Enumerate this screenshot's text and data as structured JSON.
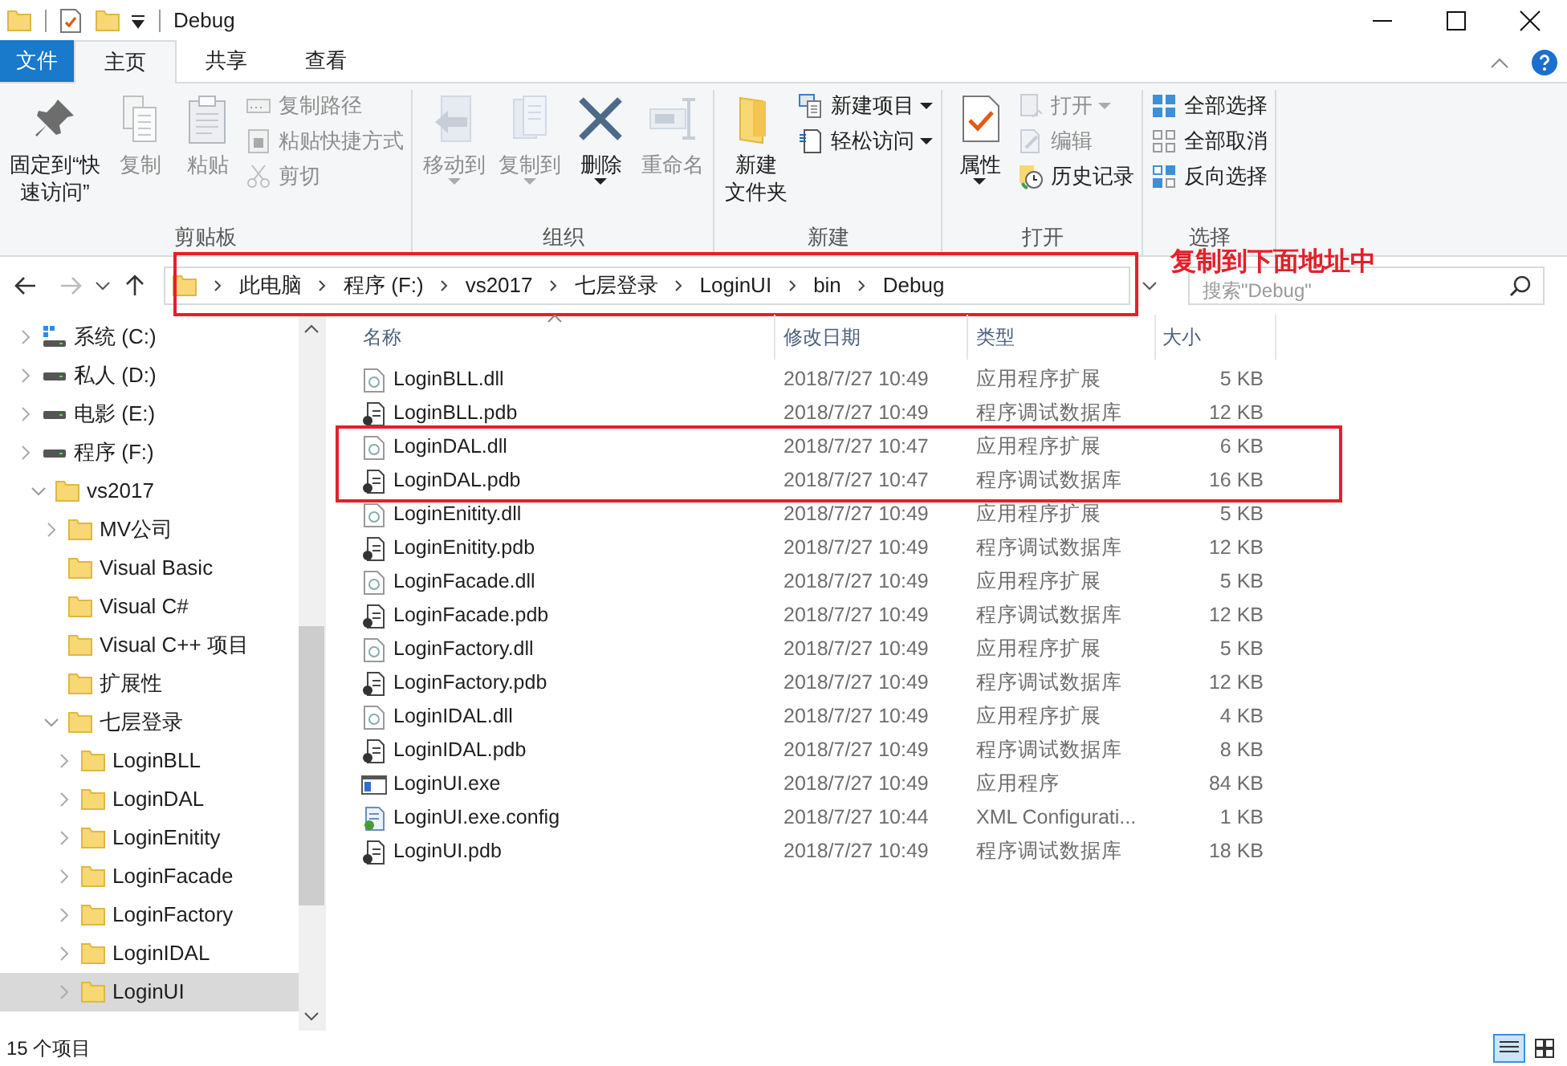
{
  "window": {
    "title": "Debug"
  },
  "ribbon_tabs": [
    {
      "label": "文件",
      "kind": "file",
      "selected": false
    },
    {
      "label": "主页",
      "kind": "tab",
      "selected": true
    },
    {
      "label": "共享",
      "kind": "tab",
      "selected": false
    },
    {
      "label": "查看",
      "kind": "tab",
      "selected": false
    }
  ],
  "ribbon_groups": [
    {
      "label": "剪贴板",
      "commands": [
        {
          "kind": "large",
          "lines": [
            "固定到“快",
            "速访问”"
          ],
          "disabled": false,
          "dropdown": false
        },
        {
          "kind": "large",
          "lines": [
            "复制"
          ],
          "disabled": true,
          "dropdown": false
        },
        {
          "kind": "large",
          "lines": [
            "粘贴"
          ],
          "disabled": true,
          "dropdown": false
        },
        {
          "kind": "small",
          "lines": [
            "复制路径"
          ],
          "disabled": true,
          "dropdown": false
        },
        {
          "kind": "small",
          "lines": [
            "粘贴快捷方式"
          ],
          "disabled": true,
          "dropdown": false
        },
        {
          "kind": "small",
          "lines": [
            "剪切"
          ],
          "disabled": true,
          "dropdown": false
        }
      ]
    },
    {
      "label": "组织",
      "commands": [
        {
          "kind": "large",
          "lines": [
            "移动到"
          ],
          "disabled": true,
          "dropdown": true
        },
        {
          "kind": "large",
          "lines": [
            "复制到"
          ],
          "disabled": true,
          "dropdown": true
        },
        {
          "kind": "large",
          "lines": [
            "删除"
          ],
          "disabled": false,
          "dropdown": true
        },
        {
          "kind": "large",
          "lines": [
            "重命名"
          ],
          "disabled": true,
          "dropdown": false
        }
      ]
    },
    {
      "label": "新建",
      "commands": [
        {
          "kind": "large",
          "lines": [
            "新建",
            "文件夹"
          ],
          "disabled": false,
          "dropdown": false
        },
        {
          "kind": "small",
          "lines": [
            "新建项目"
          ],
          "disabled": false,
          "dropdown": true
        },
        {
          "kind": "small",
          "lines": [
            "轻松访问"
          ],
          "disabled": false,
          "dropdown": true
        }
      ]
    },
    {
      "label": "打开",
      "commands": [
        {
          "kind": "large",
          "lines": [
            "属性"
          ],
          "disabled": false,
          "dropdown": true
        },
        {
          "kind": "small",
          "lines": [
            "打开"
          ],
          "disabled": true,
          "dropdown": true
        },
        {
          "kind": "small",
          "lines": [
            "编辑"
          ],
          "disabled": true,
          "dropdown": false
        },
        {
          "kind": "small",
          "lines": [
            "历史记录"
          ],
          "disabled": false,
          "dropdown": false
        }
      ]
    },
    {
      "label": "选择",
      "commands": [
        {
          "kind": "small",
          "lines": [
            "全部选择"
          ],
          "disabled": false,
          "dropdown": false
        },
        {
          "kind": "small",
          "lines": [
            "全部取消"
          ],
          "disabled": false,
          "dropdown": false
        },
        {
          "kind": "small",
          "lines": [
            "反向选择"
          ],
          "disabled": false,
          "dropdown": false
        }
      ]
    }
  ],
  "address_bar": {
    "crumbs": [
      "此电脑",
      "程序 (F:)",
      "vs2017",
      "七层登录",
      "LoginUI",
      "bin",
      "Debug"
    ]
  },
  "search": {
    "placeholder": "搜索\"Debug\""
  },
  "annotation": {
    "text": "复制到下面地址中"
  },
  "sidebar": {
    "items": [
      {
        "label": "系统 (C:)",
        "kind": "system-drive",
        "expandable": true,
        "expanded": false,
        "selected": false
      },
      {
        "label": "私人 (D:)",
        "kind": "drive",
        "expandable": true,
        "expanded": false,
        "selected": false
      },
      {
        "label": "电影 (E:)",
        "kind": "drive",
        "expandable": true,
        "expanded": false,
        "selected": false
      },
      {
        "label": "程序 (F:)",
        "kind": "drive",
        "expandable": true,
        "expanded": false,
        "selected": false,
        "children": [
          {
            "label": "vs2017",
            "kind": "folder",
            "expandable": true,
            "expanded": true,
            "selected": false,
            "children": [
              {
                "label": "MV公司",
                "kind": "folder",
                "expandable": true,
                "expanded": false,
                "selected": false
              },
              {
                "label": "Visual Basic",
                "kind": "folder",
                "expandable": false,
                "selected": false
              },
              {
                "label": "Visual C#",
                "kind": "folder",
                "expandable": false,
                "selected": false
              },
              {
                "label": "Visual C++ 项目",
                "kind": "folder",
                "expandable": false,
                "selected": false
              },
              {
                "label": "扩展性",
                "kind": "folder",
                "expandable": false,
                "selected": false
              },
              {
                "label": "七层登录",
                "kind": "folder",
                "expandable": true,
                "expanded": true,
                "selected": false,
                "children": [
                  {
                    "label": "LoginBLL",
                    "kind": "folder",
                    "expandable": true,
                    "expanded": false,
                    "selected": false
                  },
                  {
                    "label": "LoginDAL",
                    "kind": "folder",
                    "expandable": true,
                    "expanded": false,
                    "selected": false
                  },
                  {
                    "label": "LoginEnitity",
                    "kind": "folder",
                    "expandable": true,
                    "expanded": false,
                    "selected": false
                  },
                  {
                    "label": "LoginFacade",
                    "kind": "folder",
                    "expandable": true,
                    "expanded": false,
                    "selected": false
                  },
                  {
                    "label": "LoginFactory",
                    "kind": "folder",
                    "expandable": true,
                    "expanded": false,
                    "selected": false
                  },
                  {
                    "label": "LoginIDAL",
                    "kind": "folder",
                    "expandable": true,
                    "expanded": false,
                    "selected": false
                  },
                  {
                    "label": "LoginUI",
                    "kind": "folder",
                    "expandable": true,
                    "expanded": false,
                    "selected": true
                  }
                ]
              }
            ]
          }
        ]
      }
    ]
  },
  "file_list": {
    "columns": [
      {
        "label": "名称",
        "sorted": true
      },
      {
        "label": "修改日期",
        "sorted": false
      },
      {
        "label": "类型",
        "sorted": false
      },
      {
        "label": "大小",
        "sorted": false
      }
    ],
    "files": [
      {
        "name": "LoginBLL.dll",
        "date": "2018/7/27 10:49",
        "type": "应用程序扩展",
        "size": "5 KB",
        "kind": "dll",
        "marked": false
      },
      {
        "name": "LoginBLL.pdb",
        "date": "2018/7/27 10:49",
        "type": "程序调试数据库",
        "size": "12 KB",
        "kind": "pdb",
        "marked": false
      },
      {
        "name": "LoginDAL.dll",
        "date": "2018/7/27 10:47",
        "type": "应用程序扩展",
        "size": "6 KB",
        "kind": "dll",
        "marked": true
      },
      {
        "name": "LoginDAL.pdb",
        "date": "2018/7/27 10:47",
        "type": "程序调试数据库",
        "size": "16 KB",
        "kind": "pdb",
        "marked": true
      },
      {
        "name": "LoginEnitity.dll",
        "date": "2018/7/27 10:49",
        "type": "应用程序扩展",
        "size": "5 KB",
        "kind": "dll",
        "marked": false
      },
      {
        "name": "LoginEnitity.pdb",
        "date": "2018/7/27 10:49",
        "type": "程序调试数据库",
        "size": "12 KB",
        "kind": "pdb",
        "marked": false
      },
      {
        "name": "LoginFacade.dll",
        "date": "2018/7/27 10:49",
        "type": "应用程序扩展",
        "size": "5 KB",
        "kind": "dll",
        "marked": false
      },
      {
        "name": "LoginFacade.pdb",
        "date": "2018/7/27 10:49",
        "type": "程序调试数据库",
        "size": "12 KB",
        "kind": "pdb",
        "marked": false
      },
      {
        "name": "LoginFactory.dll",
        "date": "2018/7/27 10:49",
        "type": "应用程序扩展",
        "size": "5 KB",
        "kind": "dll",
        "marked": false
      },
      {
        "name": "LoginFactory.pdb",
        "date": "2018/7/27 10:49",
        "type": "程序调试数据库",
        "size": "12 KB",
        "kind": "pdb",
        "marked": false
      },
      {
        "name": "LoginIDAL.dll",
        "date": "2018/7/27 10:49",
        "type": "应用程序扩展",
        "size": "4 KB",
        "kind": "dll",
        "marked": false
      },
      {
        "name": "LoginIDAL.pdb",
        "date": "2018/7/27 10:49",
        "type": "程序调试数据库",
        "size": "8 KB",
        "kind": "pdb",
        "marked": false
      },
      {
        "name": "LoginUI.exe",
        "date": "2018/7/27 10:49",
        "type": "应用程序",
        "size": "84 KB",
        "kind": "exe",
        "marked": false
      },
      {
        "name": "LoginUI.exe.config",
        "date": "2018/7/27 10:44",
        "type": "XML Configurati...",
        "size": "1 KB",
        "kind": "config",
        "marked": false
      },
      {
        "name": "LoginUI.pdb",
        "date": "2018/7/27 10:49",
        "type": "程序调试数据库",
        "size": "18 KB",
        "kind": "pdb",
        "marked": false
      }
    ]
  },
  "status_bar": {
    "text": "15 个项目"
  }
}
